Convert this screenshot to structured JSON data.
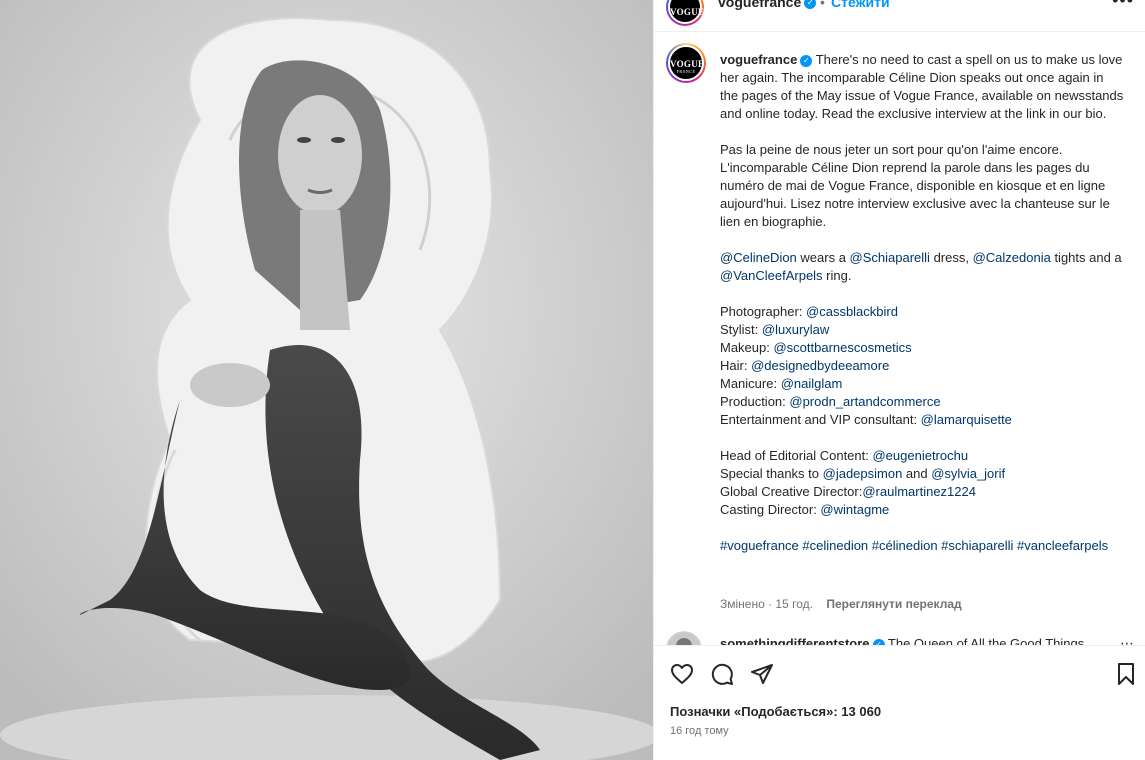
{
  "header": {
    "username": "voguefrance",
    "separator": "•",
    "follow_label": "Стежити",
    "more_icon": "more-icon"
  },
  "avatar": {
    "brand": "VOGUE",
    "sub": "FRANCE"
  },
  "caption": {
    "username": "voguefrance",
    "p1": "There's no need to cast a spell on us to make us love her again. The incomparable Céline Dion speaks out once again in the pages of the May issue of Vogue France, available on newsstands and online today. Read the exclusive interview at the link in our bio.",
    "p2": "Pas la peine de nous jeter un sort pour qu'on l'aime encore. L'incomparable Céline Dion reprend la parole dans les pages du numéro de mai de Vogue France, disponible en kiosque et en ligne aujourd'hui. Lisez notre interview exclusive avec la chanteuse sur le lien en biographie.",
    "wear": {
      "m1": "@CelineDion",
      "t1": " wears a ",
      "m2": "@Schiaparelli",
      "t2": " dress, ",
      "m3": "@Calzedonia",
      "t3": " tights and a ",
      "m4": "@VanCleefArpels",
      "t4": " ring."
    },
    "credits": [
      {
        "label": "Photographer: ",
        "mention": "@cassblackbird"
      },
      {
        "label": "Stylist: ",
        "mention": "@luxurylaw"
      },
      {
        "label": "Makeup: ",
        "mention": "@scottbarnescosmetics"
      },
      {
        "label": "Hair: ",
        "mention": "@designedbydeeamore"
      },
      {
        "label": "Manicure: ",
        "mention": "@nailglam"
      },
      {
        "label": "Production: ",
        "mention": "@prodn_artandcommerce"
      },
      {
        "label": "Entertainment and VIP consultant: ",
        "mention": "@lamarquisette"
      }
    ],
    "head": {
      "label": "Head of Editorial Content: ",
      "mention": "@eugenietrochu"
    },
    "thanks": {
      "label": "Special thanks to ",
      "m1": "@jadepsimon",
      "and": " and ",
      "m2": "@sylvia_jorif"
    },
    "creative": {
      "label": "Global Creative Director:",
      "mention": "@raulmartinez1224"
    },
    "casting": {
      "label": "Casting Director: ",
      "mention": "@wintagme"
    },
    "hashtags": "#voguefrance #celinedion #célinedion #schiaparelli #vancleefarpels",
    "edited": "Змінено · 15 год.",
    "translate": "Переглянути переклад"
  },
  "comment2": {
    "username": "somethingdifferentstore",
    "text": "The Queen of All the Good Things"
  },
  "actions": {
    "likes": "Позначки «Подобається»: 13 060",
    "time": "16 год тому"
  }
}
